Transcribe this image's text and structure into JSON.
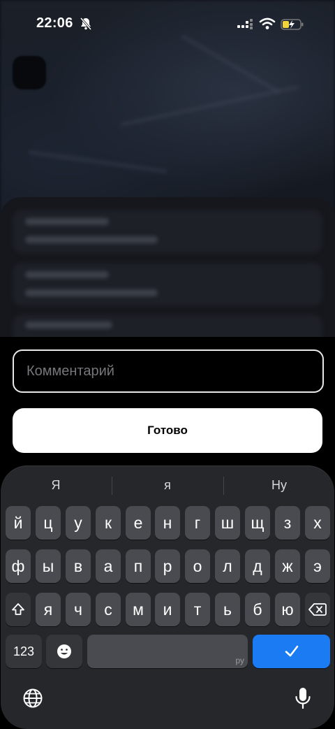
{
  "status_bar": {
    "time": "22:06"
  },
  "comment": {
    "placeholder": "Комментарий"
  },
  "done_button": {
    "label": "Готово"
  },
  "keyboard": {
    "suggestions": [
      "Я",
      "я",
      "Ну"
    ],
    "row1": [
      "й",
      "ц",
      "у",
      "к",
      "е",
      "н",
      "г",
      "ш",
      "щ",
      "з",
      "х"
    ],
    "row2": [
      "ф",
      "ы",
      "в",
      "а",
      "п",
      "р",
      "о",
      "л",
      "д",
      "ж",
      "э"
    ],
    "row3": [
      "я",
      "ч",
      "с",
      "м",
      "и",
      "т",
      "ь",
      "б",
      "ю"
    ],
    "numbers_label": "123",
    "space_language": "ру"
  },
  "colors": {
    "accent": "#1a7bf2",
    "background": "#000000",
    "button": "#ffffff"
  },
  "icons": {
    "mute": "bell-slash-icon",
    "signal": "cellular-signal-icon",
    "wifi": "wifi-icon",
    "battery": "battery-charging-icon",
    "shift": "shift-icon",
    "delete": "backspace-icon",
    "emoji": "emoji-icon",
    "return": "checkmark-icon",
    "globe": "globe-icon",
    "mic": "microphone-icon"
  }
}
